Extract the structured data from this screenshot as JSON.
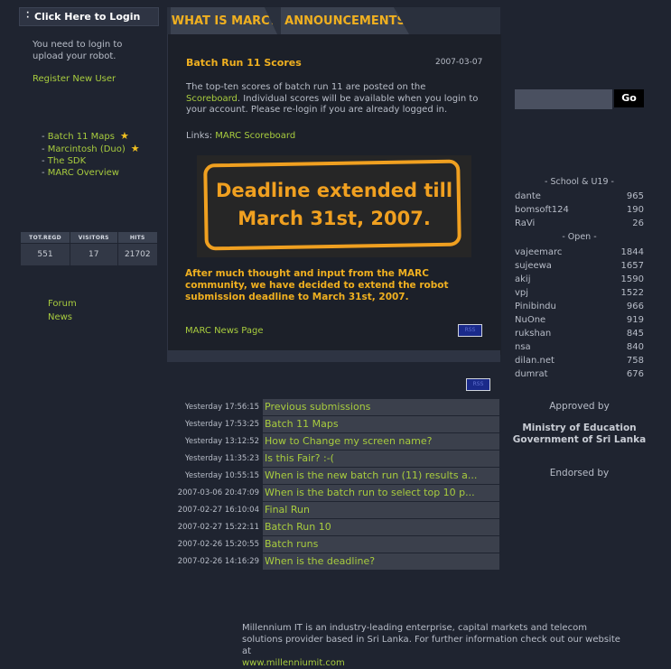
{
  "login": {
    "button_label": "Click Here to Login",
    "message": "You need to login to upload your robot.",
    "register_label": "Register New User"
  },
  "side_links": [
    {
      "label": "Batch 11 Maps",
      "starred": true
    },
    {
      "label": "Marcintosh (Duo)",
      "starred": true
    },
    {
      "label": "The SDK",
      "starred": false
    },
    {
      "label": "MARC Overview",
      "starred": false
    }
  ],
  "stats": {
    "headers": [
      "TOT.REGD",
      "VISITORS",
      "HITS"
    ],
    "values": [
      "551",
      "17",
      "21702"
    ]
  },
  "side_links2": {
    "forum": "Forum",
    "news": "News"
  },
  "tabs": {
    "tab1": "WHAT IS MARC?",
    "tab2": "ANNOUNCEMENTS"
  },
  "announcement": {
    "title": "Batch Run 11 Scores",
    "date": "2007-03-07",
    "body_prefix": "The top-ten scores of batch run 11 are posted on the ",
    "body_link": "Scoreboard",
    "body_suffix": ". Individual scores will be available when you login to your account. Please re-login if you are already logged in.",
    "links_prefix": "Links: ",
    "links_link": "MARC Scoreboard",
    "banner_line1": "Deadline extended till",
    "banner_line2": "March 31st, 2007.",
    "highlight": "After much thought and input from the MARC community, we have decided to extend the robot submission deadline to March 31st, 2007.",
    "news_page_link": "MARC News Page"
  },
  "forum_posts": [
    {
      "time": "Yesterday 17:56:15",
      "title": "Previous submissions"
    },
    {
      "time": "Yesterday 17:53:25",
      "title": "Batch 11 Maps"
    },
    {
      "time": "Yesterday 13:12:52",
      "title": "How to Change my screen name?"
    },
    {
      "time": "Yesterday 11:35:23",
      "title": "Is this Fair? :-("
    },
    {
      "time": "Yesterday 10:55:15",
      "title": "When is the new batch run (11) results a..."
    },
    {
      "time": "2007-03-06 20:47:09",
      "title": "When is the batch run to select top 10 p..."
    },
    {
      "time": "2007-02-27 16:10:04",
      "title": "Final Run"
    },
    {
      "time": "2007-02-27 15:22:11",
      "title": "Batch Run 10"
    },
    {
      "time": "2007-02-26 15:20:55",
      "title": "Batch runs"
    },
    {
      "time": "2007-02-26 14:16:29",
      "title": "When is the deadline?"
    }
  ],
  "search": {
    "value": "",
    "button_label": "Go"
  },
  "rankings": {
    "school_heading": "- School & U19 -",
    "school": [
      {
        "name": "dante",
        "score": "965"
      },
      {
        "name": "bomsoft124",
        "score": "190"
      },
      {
        "name": "RaVi",
        "score": "26"
      }
    ],
    "open_heading": "- Open -",
    "open": [
      {
        "name": "vajeemarc",
        "score": "1844"
      },
      {
        "name": "sujeewa",
        "score": "1657"
      },
      {
        "name": "akij",
        "score": "1590"
      },
      {
        "name": "vpj",
        "score": "1522"
      },
      {
        "name": "Pinibindu",
        "score": "966"
      },
      {
        "name": "NuOne",
        "score": "919"
      },
      {
        "name": "rukshan",
        "score": "845"
      },
      {
        "name": "nsa",
        "score": "840"
      },
      {
        "name": "dilan.net",
        "score": "758"
      },
      {
        "name": "dumrat",
        "score": "676"
      }
    ]
  },
  "approved_label": "Approved by",
  "ministry_line1": "Ministry of Education",
  "ministry_line2": "Government of Sri Lanka",
  "endorsed_label": "Endorsed by",
  "footer": {
    "text": "Millennium IT is an industry-leading enterprise, capital markets and telecom solutions provider based in Sri Lanka. For further information check out our website at",
    "link": "www.millenniumit.com"
  },
  "colors": {
    "background": "#1f2430",
    "accent": "#f0b020",
    "link": "#a8cc3e"
  }
}
